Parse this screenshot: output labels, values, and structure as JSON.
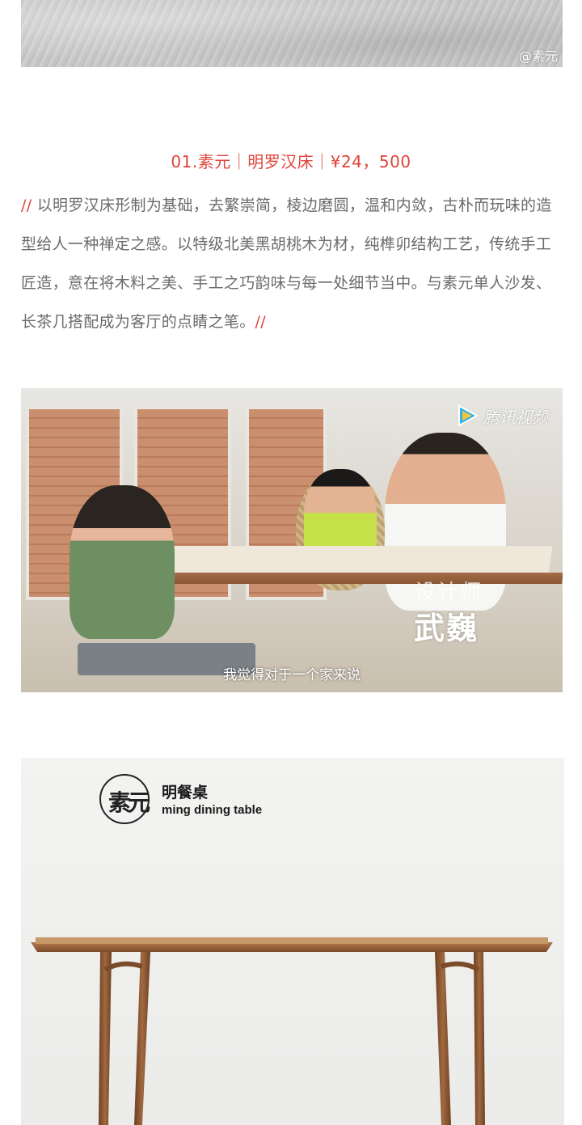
{
  "top_image": {
    "watermark": "@素元"
  },
  "product": {
    "title": "01.素元｜明罗汉床｜¥24，500",
    "slash_open": "//",
    "description": " 以明罗汉床形制为基础，去繁崇简，棱边磨圆，温和内敛，古朴而玩味的造型给人一种禅定之感。以特级北美黑胡桃木为材，纯榫卯结构工艺，传统手工匠造，意在将木料之美、手工之巧韵味与每一处细节当中。与素元单人沙发、长茶几搭配成为客厅的点睛之笔。",
    "slash_close": "//"
  },
  "video": {
    "brand": "腾讯视频",
    "brand_icon": "play-icon",
    "role": "设计师",
    "designer_name": "武巍",
    "subtitle": "我觉得对于一个家来说"
  },
  "table_image": {
    "logo_text": "素元",
    "name_cn": "明餐桌",
    "name_en": "ming dining table"
  },
  "colors": {
    "accent": "#e0453a",
    "body_text": "#6b6b6b",
    "walnut": "#8a5634"
  }
}
